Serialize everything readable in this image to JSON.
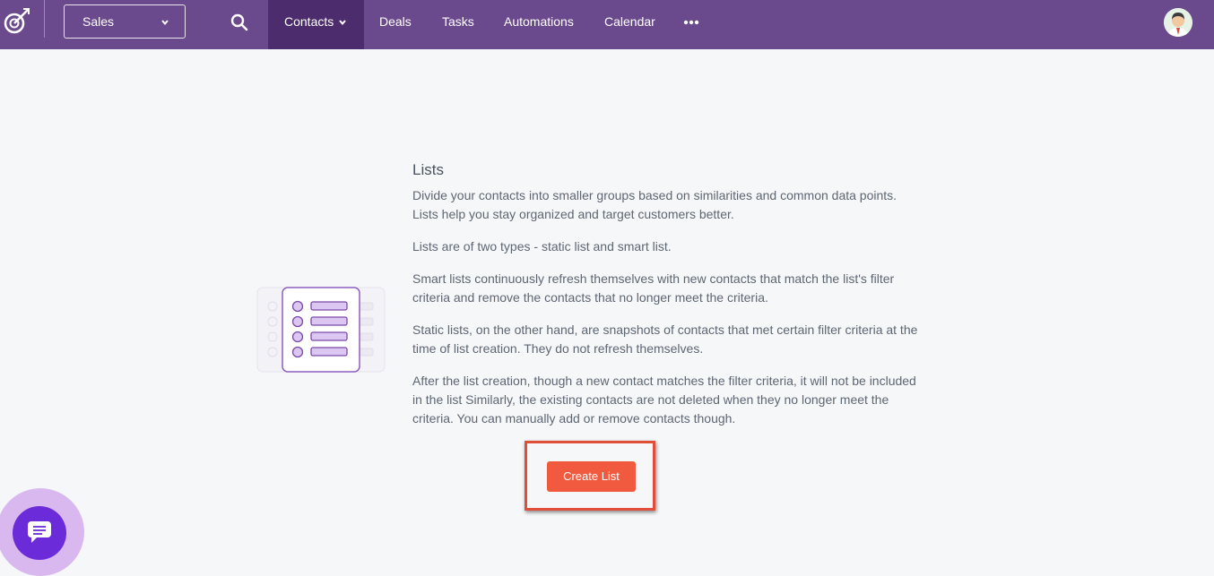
{
  "topbar": {
    "module_select": {
      "selected": "Sales"
    },
    "nav": [
      {
        "label": "Contacts",
        "active": true,
        "has_dropdown": true
      },
      {
        "label": "Deals"
      },
      {
        "label": "Tasks"
      },
      {
        "label": "Automations"
      },
      {
        "label": "Calendar"
      }
    ],
    "more_icon": "ellipsis-icon",
    "search_icon": "search-icon",
    "avatar_icon": "user-avatar"
  },
  "main": {
    "title": "Lists",
    "paragraphs": [
      "Divide your contacts into smaller groups based on similarities and common data points. Lists help you stay organized and target customers better.",
      "Lists are of two types - static list and smart list.",
      "Smart lists continuously refresh themselves with new contacts that match the list's filter criteria and remove the contacts that no longer meet the criteria.",
      "Static lists, on the other hand, are snapshots of contacts that met certain filter criteria at the time of list creation. They do not refresh themselves.",
      "After the list creation, though a new contact matches the filter criteria, it will not be included in the list Similarly, the existing contacts are not deleted when they no longer meet the criteria. You can manually add or remove contacts though."
    ],
    "create_button": "Create List"
  },
  "chat_widget": {
    "icon": "chat-icon"
  },
  "colors": {
    "topbar": "#6a4a8c",
    "active_nav": "#4c2c6c",
    "button": "#f15a3e",
    "highlight": "#e04e3a",
    "chat": "#6c2bd9"
  }
}
